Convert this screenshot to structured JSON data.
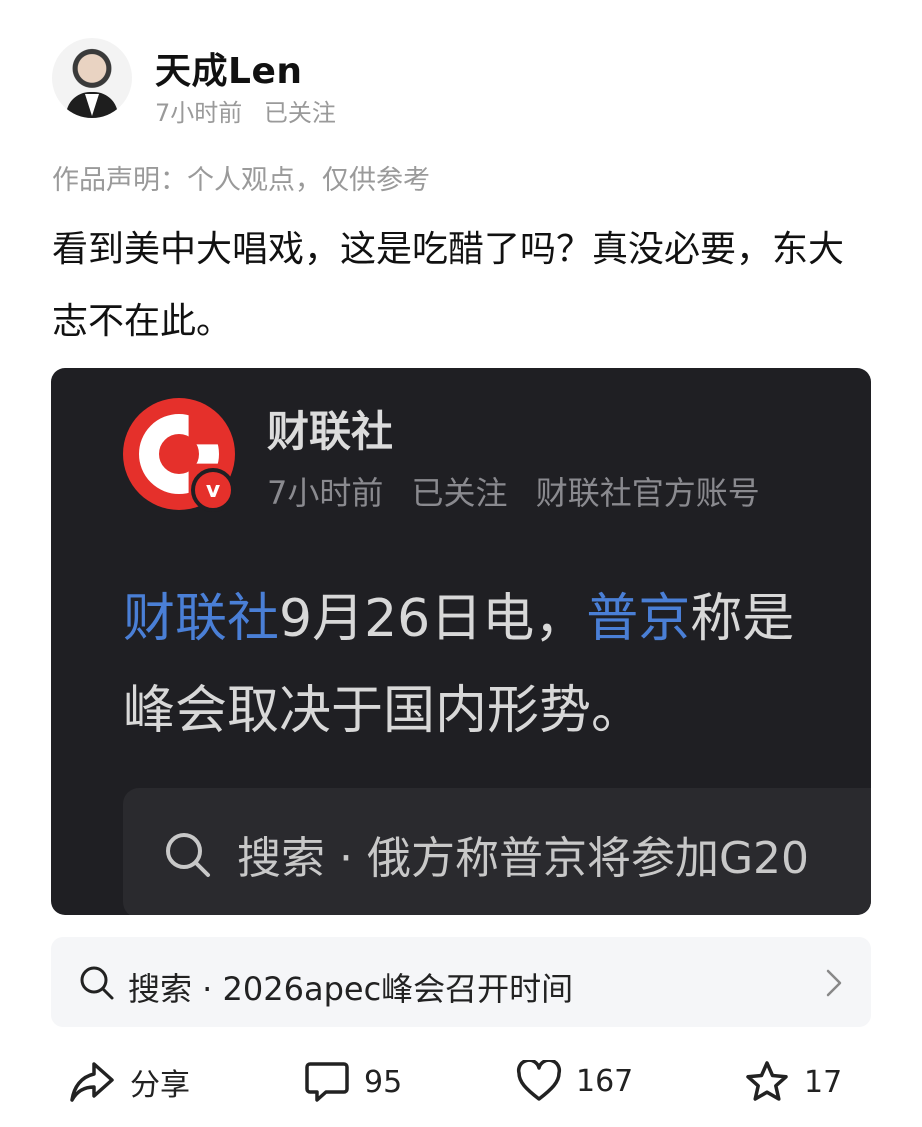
{
  "author": {
    "name": "天成Len",
    "time": "7小时前",
    "follow_status": "已关注"
  },
  "disclaimer": "作品声明：个人观点，仅供参考",
  "post_text": "看到美中大唱戏，这是吃醋了吗？真没必要，东大志不在此。",
  "embed": {
    "account_name": "财联社",
    "time": "7小时前",
    "follow_status": "已关注",
    "account_tag": "财联社官方账号",
    "logo_letter": "C",
    "badge": "v",
    "text_link1": "财联社",
    "text_part1": "9月26日电，",
    "text_link2": "普京",
    "text_part2": "称是",
    "text_line2": "峰会取决于国内形势。",
    "search_text": "搜索 · 俄方称普京将参加G20"
  },
  "search_bar": {
    "text": "搜索 · 2026apec峰会召开时间"
  },
  "actions": {
    "share_label": "分享",
    "comment_count": "95",
    "like_count": "167",
    "favorite_count": "17"
  },
  "colors": {
    "link_blue": "#4a7fd6",
    "embed_bg": "#1f1f23",
    "brand_red": "#e5302b",
    "meta_gray": "#9a9a9a"
  }
}
